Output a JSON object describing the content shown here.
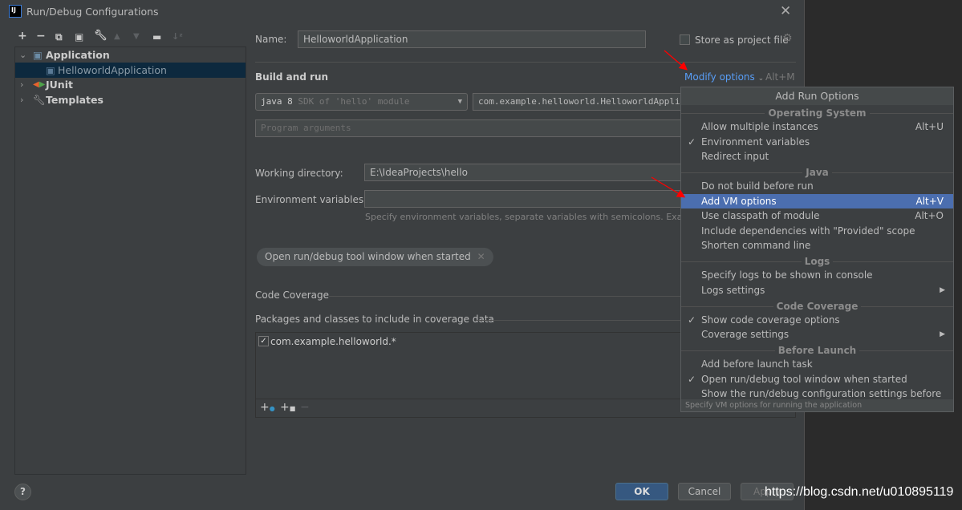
{
  "window": {
    "title": "Run/Debug Configurations",
    "logo": "IJ"
  },
  "toolbar": [
    "plus-icon",
    "minus-icon",
    "copy-icon",
    "save-icon",
    "wrench-icon",
    "arrow-up-icon",
    "arrow-down-icon",
    "new-folder-icon",
    "sort-icon"
  ],
  "tree": {
    "application": "Application",
    "selected": "HelloworldApplication",
    "junit": "JUnit",
    "templates": "Templates"
  },
  "form": {
    "name_label": "Name:",
    "name_value": "HelloworldApplication",
    "store_label": "Store as project file",
    "store_checked": false,
    "build_run": "Build and run",
    "modify_options": "Modify options",
    "modify_shortcut": "Alt+M",
    "jre_value": "java 8",
    "jre_hint": "SDK of 'hello' module",
    "main_class": "com.example.helloworld.HelloworldApplic",
    "program_args_placeholder": "Program arguments",
    "working_dir_label": "Working directory:",
    "working_dir_value": "E:\\IdeaProjects\\hello",
    "env_label": "Environment variables:",
    "env_value": "",
    "env_hint": "Specify environment variables, separate variables with semicolons. Examp",
    "chip": "Open run/debug tool window when started",
    "code_coverage": "Code Coverage",
    "packages_label": "Packages and classes to include in coverage data",
    "packages": [
      {
        "checked": true,
        "value": "com.example.helloworld.*"
      }
    ]
  },
  "buttons": {
    "ok": "OK",
    "cancel": "Cancel",
    "apply": "Apply",
    "help": "?"
  },
  "popup": {
    "title": "Add Run Options",
    "sections": [
      {
        "title": "Operating System",
        "items": [
          {
            "label": "Allow multiple instances",
            "shortcut": "Alt+U"
          },
          {
            "label": "Environment variables",
            "checked": true
          },
          {
            "label": "Redirect input"
          }
        ]
      },
      {
        "title": "Java",
        "items": [
          {
            "label": "Do not build before run"
          },
          {
            "label": "Add VM options",
            "shortcut": "Alt+V",
            "highlighted": true
          },
          {
            "label": "Use classpath of module",
            "shortcut": "Alt+O"
          },
          {
            "label": "Include dependencies with \"Provided\" scope"
          },
          {
            "label": "Shorten command line"
          }
        ]
      },
      {
        "title": "Logs",
        "items": [
          {
            "label": "Specify logs to be shown in console"
          },
          {
            "label": "Logs settings",
            "submenu": true
          }
        ]
      },
      {
        "title": "Code Coverage",
        "items": [
          {
            "label": "Show code coverage options",
            "checked": true
          },
          {
            "label": "Coverage settings",
            "submenu": true
          }
        ]
      },
      {
        "title": "Before Launch",
        "items": [
          {
            "label": "Add before launch task"
          },
          {
            "label": "Open run/debug tool window when started",
            "checked": true
          },
          {
            "label": "Show the run/debug configuration settings before start"
          }
        ]
      }
    ],
    "footer": "Specify VM options for running the application"
  },
  "watermark": "https://blog.csdn.net/u010895119",
  "colors": {
    "accent": "#4b6eaf",
    "link": "#589df6",
    "annotation_arrow": "#ff0000"
  }
}
